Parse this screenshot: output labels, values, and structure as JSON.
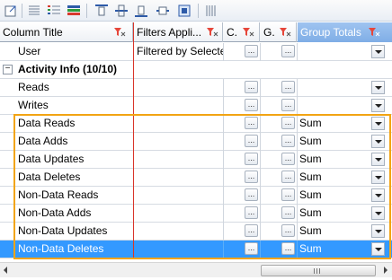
{
  "toolbar": {
    "icons": [
      "expand-icon",
      "list-icon",
      "colored-list-icon",
      "colored-bars-icon",
      "align-top-icon",
      "align-middle-icon",
      "align-bottom-icon",
      "align-center-icon",
      "fit-icon",
      "column-icon"
    ]
  },
  "columns": {
    "column_title": "Column Title",
    "filters_applied": "Filters Appli...",
    "c": "C.",
    "g": "G.",
    "group_totals": "Group Totals"
  },
  "rows": [
    {
      "title": "User",
      "filter": "Filtered by Selecte",
      "total": "",
      "type": "item"
    },
    {
      "title": "Activity Info (10/10)",
      "expander": "−",
      "type": "group"
    },
    {
      "title": "Reads",
      "filter": "",
      "total": "",
      "type": "item"
    },
    {
      "title": "Writes",
      "filter": "",
      "total": "",
      "type": "item"
    },
    {
      "title": "Data Reads",
      "filter": "",
      "total": "Sum",
      "type": "item"
    },
    {
      "title": "Data Adds",
      "filter": "",
      "total": "Sum",
      "type": "item"
    },
    {
      "title": "Data Updates",
      "filter": "",
      "total": "Sum",
      "type": "item"
    },
    {
      "title": "Data Deletes",
      "filter": "",
      "total": "Sum",
      "type": "item"
    },
    {
      "title": "Non-Data Reads",
      "filter": "",
      "total": "Sum",
      "type": "item"
    },
    {
      "title": "Non-Data Adds",
      "filter": "",
      "total": "Sum",
      "type": "item"
    },
    {
      "title": "Non-Data Updates",
      "filter": "",
      "total": "Sum",
      "type": "item"
    },
    {
      "title": "Non-Data Deletes",
      "filter": "",
      "total": "Sum",
      "type": "item",
      "selected": true
    }
  ],
  "ellipsis": "...",
  "colors": {
    "highlight": "#f2a413",
    "divider": "#d9352a",
    "selection": "#3399ff"
  }
}
